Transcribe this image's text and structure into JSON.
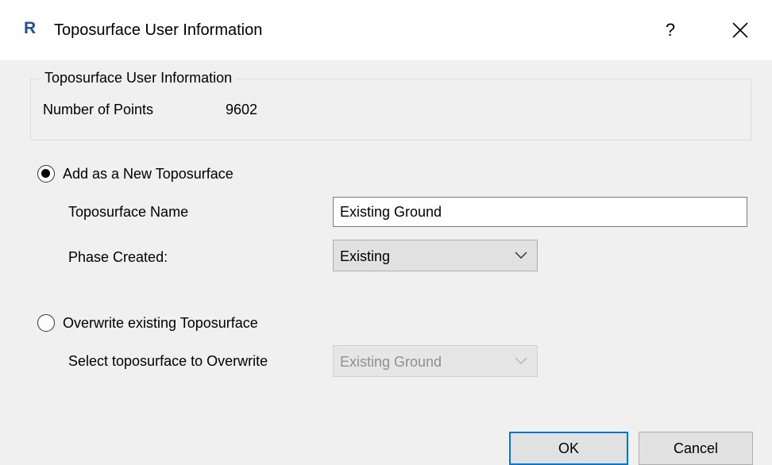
{
  "window": {
    "app_logo_letter": "R",
    "title": "Toposurface User Information",
    "help_label": "?",
    "close_icon": "close-icon"
  },
  "info_group": {
    "legend": "Toposurface User Information",
    "points_label": "Number of Points",
    "points_value": "9602"
  },
  "add_new": {
    "radio_label": "Add as a New Toposurface",
    "selected": true,
    "name_label": "Toposurface Name",
    "name_value": "Existing Ground",
    "phase_label": "Phase Created:",
    "phase_value": "Existing"
  },
  "overwrite": {
    "radio_label": "Overwrite existing Toposurface",
    "selected": false,
    "select_label": "Select toposurface to Overwrite",
    "select_value": "Existing Ground"
  },
  "buttons": {
    "ok": "OK",
    "cancel": "Cancel"
  },
  "colors": {
    "accent": "#0078d7",
    "logo": "#1f4e9b",
    "background": "#f0f0f0"
  }
}
